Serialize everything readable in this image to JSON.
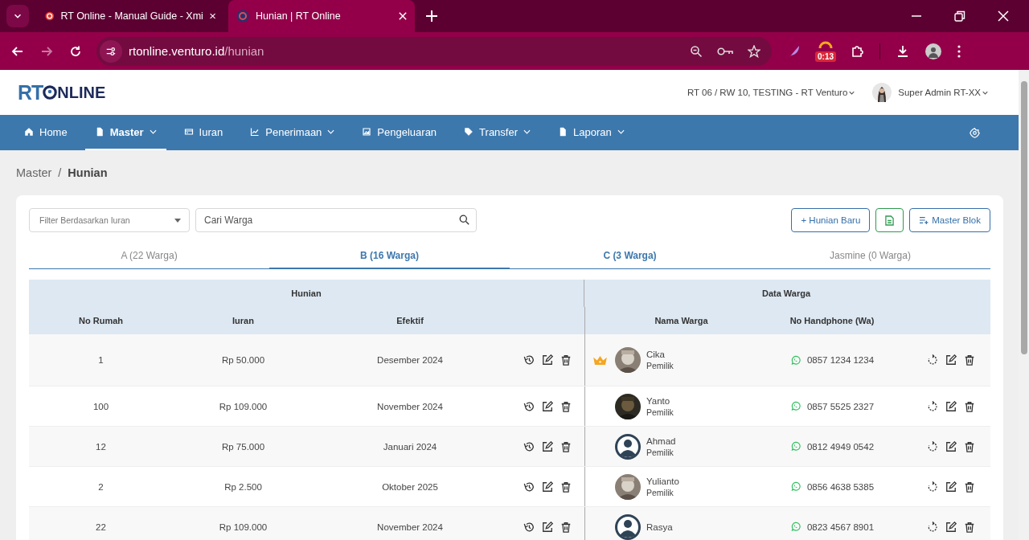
{
  "browser": {
    "tabs": [
      {
        "title": "RT Online - Manual Guide - Xmi",
        "selected": false
      },
      {
        "title": "Hunian | RT Online",
        "selected": true
      }
    ],
    "url_host": "rtonline.venturo.id",
    "url_path": "/hunian",
    "extension_badge": "0:13"
  },
  "header": {
    "logo_left": "RT",
    "logo_right": "NLINE",
    "organization": "RT 06 / RW 10, TESTING - RT Venturo",
    "user": "Super Admin RT-XX"
  },
  "nav": [
    {
      "label": "Home",
      "dropdown": false,
      "selected": false
    },
    {
      "label": "Master",
      "dropdown": true,
      "selected": true
    },
    {
      "label": "Iuran",
      "dropdown": false,
      "selected": false
    },
    {
      "label": "Penerimaan",
      "dropdown": true,
      "selected": false
    },
    {
      "label": "Pengeluaran",
      "dropdown": false,
      "selected": false
    },
    {
      "label": "Transfer",
      "dropdown": true,
      "selected": false
    },
    {
      "label": "Laporan",
      "dropdown": true,
      "selected": false
    }
  ],
  "breadcrumb": {
    "items": [
      "Master",
      "Hunian"
    ],
    "separator": "/"
  },
  "filter": {
    "placeholder": "Filter Berdasarkan Iuran"
  },
  "search": {
    "placeholder": "Cari Warga"
  },
  "buttons": [
    {
      "label": "+ Hunian Baru",
      "kind": "text"
    },
    {
      "kind": "excel"
    },
    {
      "label": "Master Blok",
      "kind": "list"
    }
  ],
  "block_tabs": [
    {
      "label": "A (22 Warga)",
      "selected": false,
      "hovered": false
    },
    {
      "label": "B (16 Warga)",
      "selected": true,
      "hovered": false
    },
    {
      "label": "C (3 Warga)",
      "selected": false,
      "hovered": true
    },
    {
      "label": "Jasmine (0 Warga)",
      "selected": false,
      "hovered": false
    }
  ],
  "table": {
    "groups": [
      "Hunian",
      "Data Warga"
    ],
    "columns": [
      "No Rumah",
      "Iuran",
      "Efektif",
      "Nama Warga",
      "No Handphone (Wa)"
    ],
    "rows": [
      {
        "no_rumah": "1",
        "iuran": "Rp 50.000",
        "efektif": "Desember 2024",
        "head": true,
        "name": "Cika",
        "role": "Pemilik",
        "phone": "0857 1234 1234"
      },
      {
        "no_rumah": "100",
        "iuran": "Rp 109.000",
        "efektif": "November 2024",
        "head": false,
        "name": "Yanto",
        "role": "Pemilik",
        "phone": "0857 5525 2327"
      },
      {
        "no_rumah": "12",
        "iuran": "Rp 75.000",
        "efektif": "Januari 2024",
        "head": false,
        "avatar": {
          "kind": "default"
        },
        "name": "Ahmad",
        "role": "Pemilik",
        "phone": "0812 4949 0542"
      },
      {
        "no_rumah": "2",
        "iuran": "Rp 2.500",
        "efektif": "Oktober 2025",
        "head": false,
        "name": "Yulianto",
        "role": "Pemilik",
        "phone": "0856 4638 5385"
      },
      {
        "no_rumah": "22",
        "iuran": "Rp 109.000",
        "efektif": "November 2024",
        "head": false,
        "avatar": {
          "kind": "default"
        },
        "name": "Rasya",
        "phone": "0823 4567 8901"
      }
    ]
  }
}
